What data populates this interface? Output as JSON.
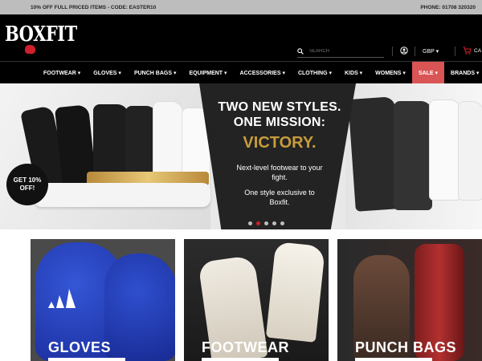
{
  "promo": {
    "left": "10% OFF FULL PRICED ITEMS - CODE: EASTER10",
    "right": "PHONE: 01708 320320"
  },
  "header": {
    "logo_text": "BOXFIT",
    "search_placeholder": "SEARCH",
    "currency": "GBP",
    "cart_label": "CA"
  },
  "nav": {
    "items": [
      {
        "label": "FOOTWEAR ▾"
      },
      {
        "label": "GLOVES ▾"
      },
      {
        "label": "PUNCH BAGS ▾"
      },
      {
        "label": "EQUIPMENT ▾"
      },
      {
        "label": "ACCESSORIES ▾"
      },
      {
        "label": "CLOTHING ▾"
      },
      {
        "label": "KIDS ▾"
      },
      {
        "label": "WOMENS ▾"
      },
      {
        "label": "SALE ▾"
      },
      {
        "label": "BRANDS ▾"
      }
    ]
  },
  "hero": {
    "headline_1": "TWO NEW STYLES.",
    "headline_2": "ONE MISSION:",
    "highlight": "VICTORY.",
    "body_1": "Next-level footwear to your fight.",
    "body_2": "One style exclusive to Boxfit.",
    "badge": "GET 10% OFF!",
    "slide_count": 5,
    "active_slide": 2
  },
  "tiles": [
    {
      "label": "GLOVES"
    },
    {
      "label": "FOOTWEAR"
    },
    {
      "label": "PUNCH BAGS"
    }
  ],
  "colors": {
    "accent_red": "#d01f2c",
    "sale_bg": "#d95555",
    "gold": "#c79c3c"
  }
}
